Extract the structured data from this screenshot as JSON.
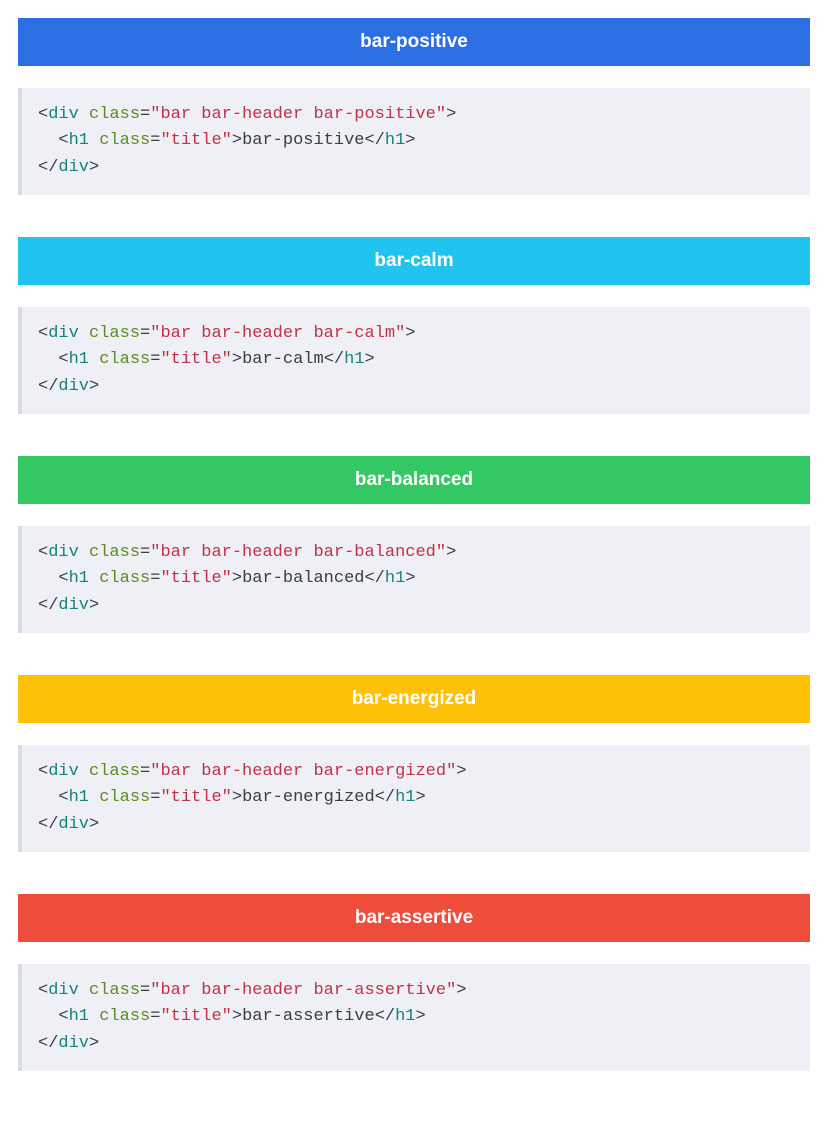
{
  "items": [
    {
      "label": "bar-positive",
      "colorClass": "bar-positive",
      "code": {
        "outerClass": "bar bar-header bar-positive",
        "innerClass": "title",
        "innerText": "bar-positive"
      }
    },
    {
      "label": "bar-calm",
      "colorClass": "bar-calm",
      "code": {
        "outerClass": "bar bar-header bar-calm",
        "innerClass": "title",
        "innerText": "bar-calm"
      }
    },
    {
      "label": "bar-balanced",
      "colorClass": "bar-balanced",
      "code": {
        "outerClass": "bar bar-header bar-balanced",
        "innerClass": "title",
        "innerText": "bar-balanced"
      }
    },
    {
      "label": "bar-energized",
      "colorClass": "bar-energized",
      "code": {
        "outerClass": "bar bar-header bar-energized",
        "innerClass": "title",
        "innerText": "bar-energized"
      }
    },
    {
      "label": "bar-assertive",
      "colorClass": "bar-assertive",
      "code": {
        "outerClass": "bar bar-header bar-assertive",
        "innerClass": "title",
        "innerText": "bar-assertive"
      }
    }
  ],
  "colors": {
    "bar-positive": "#2b6fe3",
    "bar-calm": "#21c4ef",
    "bar-balanced": "#33c863",
    "bar-energized": "#ffc107",
    "bar-assertive": "#ef4d3c"
  }
}
